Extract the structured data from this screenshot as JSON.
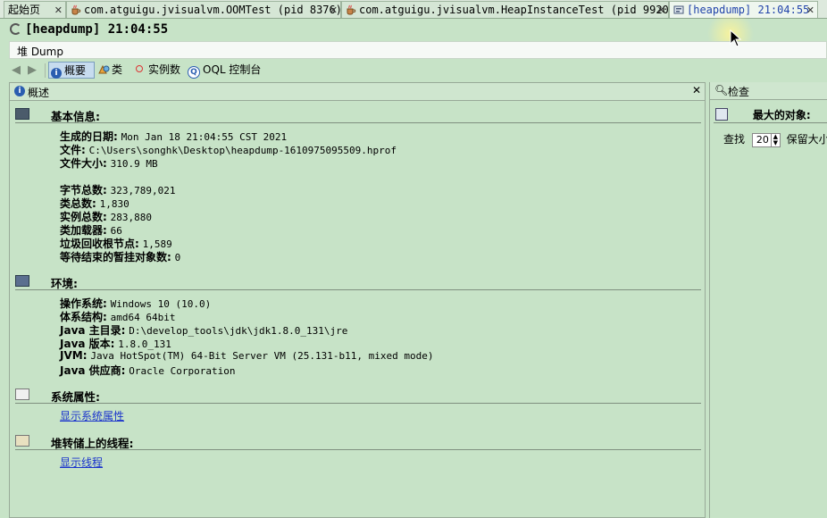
{
  "tabs": [
    {
      "label": "起始页"
    },
    {
      "label": "com.atguigu.jvisualvm.OOMTest (pid 8376)"
    },
    {
      "label": "com.atguigu.jvisualvm.HeapInstanceTest (pid 9920)"
    },
    {
      "label": "[heapdump] 21:04:55"
    }
  ],
  "window_title": "[heapdump] 21:04:55",
  "subtab_label": "堆 Dump",
  "toolbar": {
    "overview": "概要",
    "classes": "类",
    "instances": "实例数",
    "oql": "OQL 控制台"
  },
  "overview_panel": {
    "title": "概述",
    "basic_info": {
      "heading": "基本信息:",
      "rows": [
        {
          "label": "生成的日期:",
          "value": "Mon Jan 18 21:04:55 CST 2021"
        },
        {
          "label": "文件:",
          "value": "C:\\Users\\songhk\\Desktop\\heapdump-1610975095509.hprof"
        },
        {
          "label": "文件大小:",
          "value": "310.9 MB"
        },
        {
          "label": "字节总数:",
          "value": "323,789,021"
        },
        {
          "label": "类总数:",
          "value": "1,830"
        },
        {
          "label": "实例总数:",
          "value": "283,880"
        },
        {
          "label": "类加载器:",
          "value": "66"
        },
        {
          "label": "垃圾回收根节点:",
          "value": "1,589"
        },
        {
          "label": "等待结束的暂挂对象数:",
          "value": "0"
        }
      ]
    },
    "environment": {
      "heading": "环境:",
      "rows": [
        {
          "label": "操作系统:",
          "value": "Windows 10 (10.0)"
        },
        {
          "label": "体系结构:",
          "value": "amd64 64bit"
        },
        {
          "label": "Java 主目录:",
          "value": "D:\\develop_tools\\jdk\\jdk1.8.0_131\\jre"
        },
        {
          "label": "Java 版本:",
          "value": "1.8.0_131"
        },
        {
          "label": "JVM:",
          "value": "Java HotSpot(TM) 64-Bit Server VM (25.131-b11, mixed mode)"
        },
        {
          "label": "Java 供应商:",
          "value": "Oracle Corporation"
        }
      ]
    },
    "system_properties": {
      "heading": "系统属性:",
      "link": "显示系统属性"
    },
    "threads": {
      "heading": "堆转储上的线程:",
      "link": "显示线程"
    }
  },
  "inspect_panel": {
    "title": "检查",
    "heading": "最大的对象:",
    "find_label": "查找",
    "find_count": "20",
    "retain_label": "保留大小"
  },
  "colors": {
    "background": "#c7e3c7",
    "link": "#1a33cc",
    "active_tab_text": "#2244aa"
  }
}
